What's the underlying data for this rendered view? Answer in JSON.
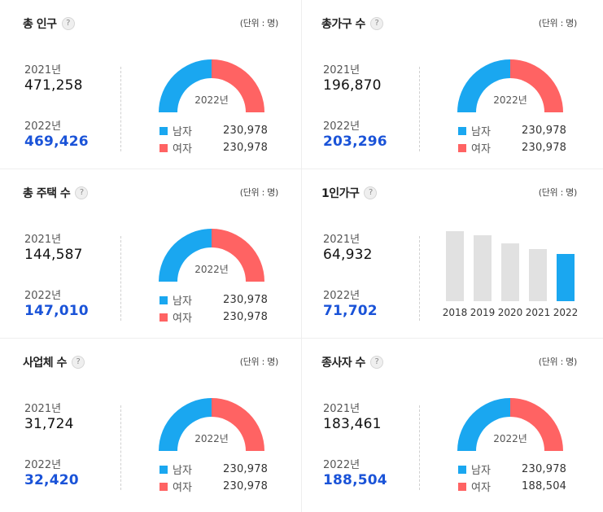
{
  "colors": {
    "male": "#1aa7f0",
    "female": "#ff6363",
    "bar_past": "#e1e1e1",
    "bar_current": "#1aa7f0",
    "highlight": "#1a53d8"
  },
  "unit_text": "(단위 : 명)",
  "help_icon": "?",
  "cards": [
    {
      "title": "총 인구",
      "y1_label": "2021년",
      "y1_value": "471,258",
      "y2_label": "2022년",
      "y2_value": "469,426",
      "donut_label": "2022년",
      "male_label": "남자",
      "male_value": "230,978",
      "female_label": "여자",
      "female_value": "230,978",
      "male_share": 0.5
    },
    {
      "title": "총가구 수",
      "y1_label": "2021년",
      "y1_value": "196,870",
      "y2_label": "2022년",
      "y2_value": "203,296",
      "donut_label": "2022년",
      "male_label": "남자",
      "male_value": "230,978",
      "female_label": "여자",
      "female_value": "230,978",
      "male_share": 0.5
    },
    {
      "title": "총 주택 수",
      "y1_label": "2021년",
      "y1_value": "144,587",
      "y2_label": "2022년",
      "y2_value": "147,010",
      "donut_label": "2022년",
      "male_label": "남자",
      "male_value": "230,978",
      "female_label": "여자",
      "female_value": "230,978",
      "male_share": 0.5
    },
    {
      "title": "1인가구",
      "y1_label": "2021년",
      "y1_value": "64,932",
      "y2_label": "2022년",
      "y2_value": "71,702"
    },
    {
      "title": "사업체 수",
      "y1_label": "2021년",
      "y1_value": "31,724",
      "y2_label": "2022년",
      "y2_value": "32,420",
      "donut_label": "2022년",
      "male_label": "남자",
      "male_value": "230,978",
      "female_label": "여자",
      "female_value": "230,978",
      "male_share": 0.5
    },
    {
      "title": "종사자 수",
      "y1_label": "2021년",
      "y1_value": "183,461",
      "y2_label": "2022년",
      "y2_value": "188,504",
      "donut_label": "2022년",
      "male_label": "남자",
      "male_value": "230,978",
      "female_label": "여자",
      "female_value": "188,504",
      "male_share": 0.5
    }
  ],
  "chart_data": {
    "type": "bar",
    "categories": [
      "2018",
      "2019",
      "2020",
      "2021",
      "2022"
    ],
    "values": [
      86,
      81,
      71,
      64,
      58
    ],
    "highlight_category": "2022"
  }
}
